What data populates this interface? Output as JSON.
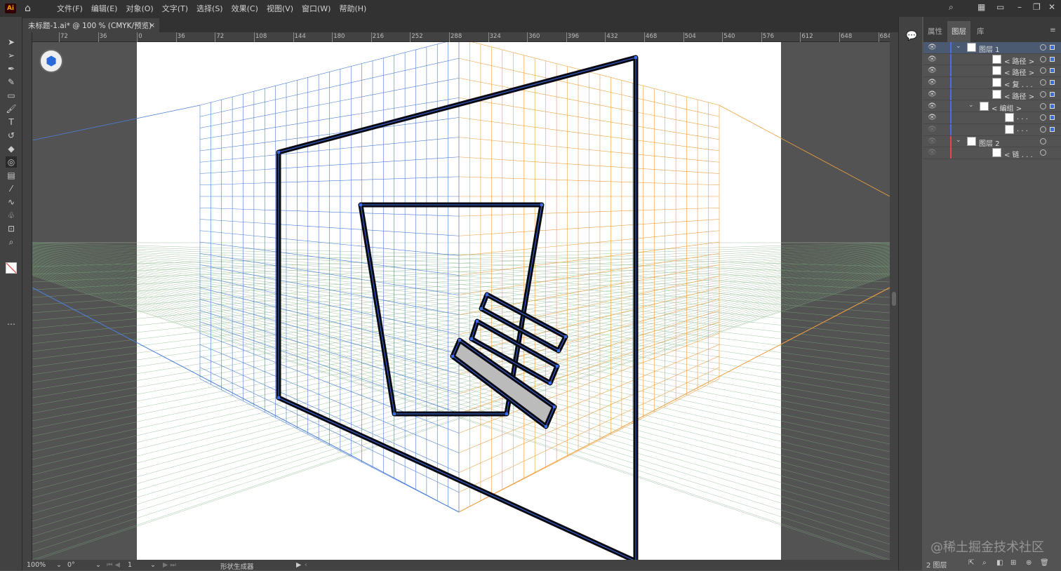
{
  "app": {
    "logo": "Ai",
    "menus": [
      "文件(F)",
      "编辑(E)",
      "对象(O)",
      "文字(T)",
      "选择(S)",
      "效果(C)",
      "视图(V)",
      "窗口(W)",
      "帮助(H)"
    ]
  },
  "document": {
    "tab_title": "未标题-1.ai* @ 100 % (CMYK/预览)",
    "close": "×"
  },
  "ruler": {
    "labels": [
      "72",
      "36",
      "0",
      "36",
      "72",
      "108",
      "144",
      "180",
      "216",
      "252",
      "288",
      "324",
      "360",
      "396",
      "432",
      "468",
      "504",
      "540",
      "576",
      "612",
      "648",
      "684"
    ]
  },
  "status": {
    "zoom": "100%",
    "rotation": "0°",
    "artboard": "1",
    "tool": "形状生成器"
  },
  "panel": {
    "tabs": [
      "属性",
      "图层",
      "库"
    ],
    "active_tab": "图层",
    "layers": [
      {
        "name": "图层 1",
        "indent": 0,
        "expand": true,
        "visible": true,
        "color": "#4a6fe0",
        "selected": true
      },
      {
        "name": "< 路径 >",
        "indent": 2,
        "visible": true,
        "color": "#4a6fe0"
      },
      {
        "name": "< 路径 >",
        "indent": 2,
        "visible": true,
        "color": "#4a6fe0"
      },
      {
        "name": "< 复 . . .",
        "indent": 2,
        "visible": true,
        "color": "#4a6fe0"
      },
      {
        "name": "< 路径 >",
        "indent": 2,
        "visible": true,
        "color": "#4a6fe0"
      },
      {
        "name": "< 编组 >",
        "indent": 1,
        "expand": true,
        "visible": true,
        "color": "#4a6fe0"
      },
      {
        "name": ". . .",
        "indent": 3,
        "visible": true,
        "color": "#4a6fe0"
      },
      {
        "name": ". . .",
        "indent": 3,
        "visible": false,
        "color": "#4a6fe0"
      },
      {
        "name": "图层 2",
        "indent": 0,
        "expand": true,
        "visible": false,
        "color": "#e04a4a"
      },
      {
        "name": "< 链 . . .",
        "indent": 2,
        "visible": false,
        "color": "#e04a4a"
      }
    ],
    "footer": "2 图层"
  },
  "watermark": "@稀土掘金技术社区",
  "colors": {
    "grid_left": "#4a7fd8",
    "grid_right": "#f0a040",
    "grid_ground": "#7fb07f",
    "stroke": "#0a0a14",
    "anchor": "#3b6bdf"
  }
}
